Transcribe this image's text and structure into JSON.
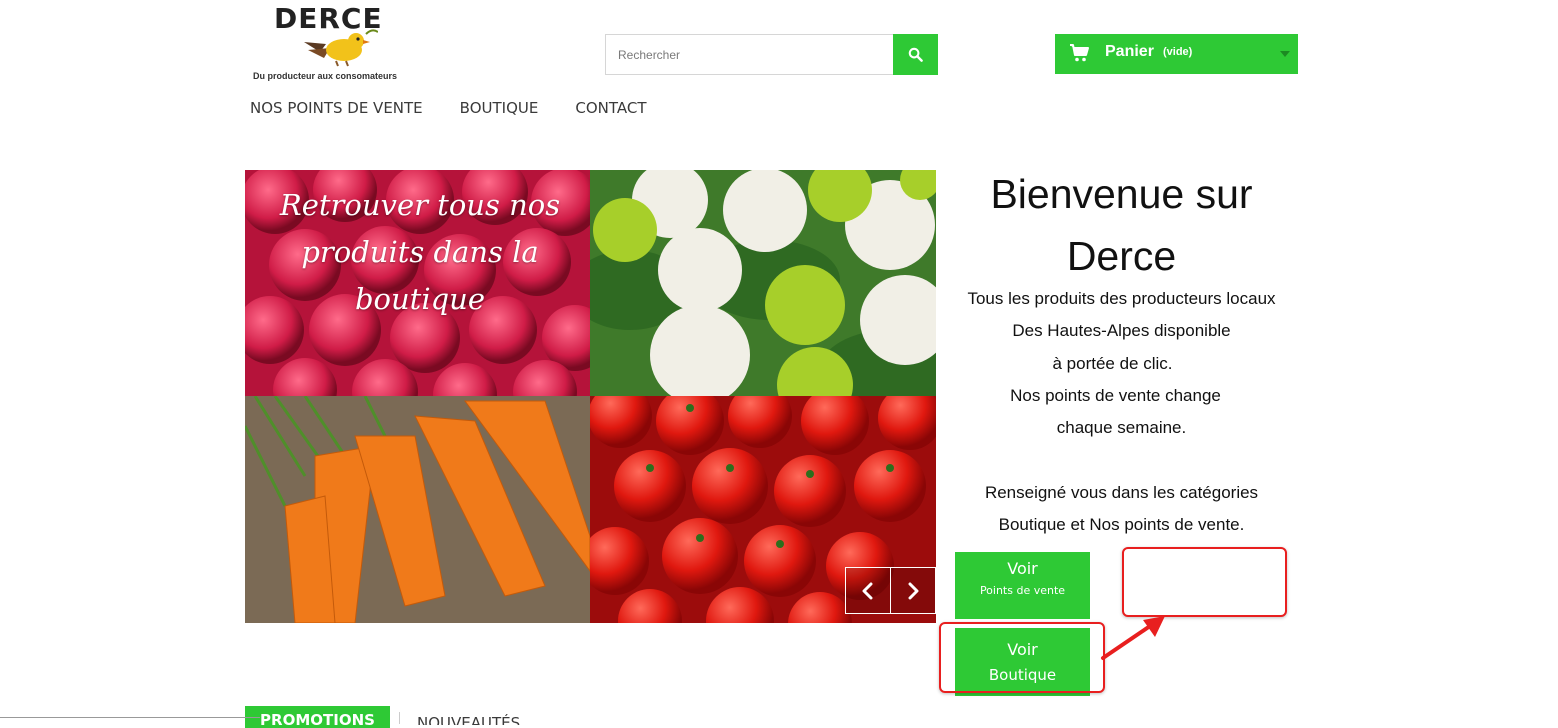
{
  "brand": {
    "name": "DERCE",
    "tagline": "Du producteur aux consomateurs"
  },
  "search": {
    "placeholder": "Rechercher"
  },
  "cart": {
    "label": "Panier",
    "status": "(vide)"
  },
  "nav": {
    "items": [
      {
        "label": "NOS POINTS DE VENTE"
      },
      {
        "label": "BOUTIQUE"
      },
      {
        "label": "CONTACT"
      }
    ]
  },
  "slider": {
    "caption": "Retrouver tous nos produits dans la boutique"
  },
  "welcome": {
    "title_line1": "Bienvenue sur",
    "title_line2": "Derce",
    "lines": [
      "Tous les produits des producteurs locaux",
      "Des Hautes-Alpes disponible",
      "à portée de clic.",
      "Nos points de vente change",
      "chaque semaine.",
      "",
      "Renseigné vous dans les catégories",
      "Boutique et Nos points de vente."
    ]
  },
  "buttons": {
    "points_de_vente": {
      "line1": "Voir",
      "line2": "Points de vente"
    },
    "boutique": {
      "line1": "Voir",
      "line2": "Boutique"
    }
  },
  "tabs": {
    "promotions": "PROMOTIONS",
    "nouveautes": "NOUVEAUTÉS"
  },
  "colors": {
    "accent": "#2ec935",
    "annotation": "#e81f1f"
  }
}
